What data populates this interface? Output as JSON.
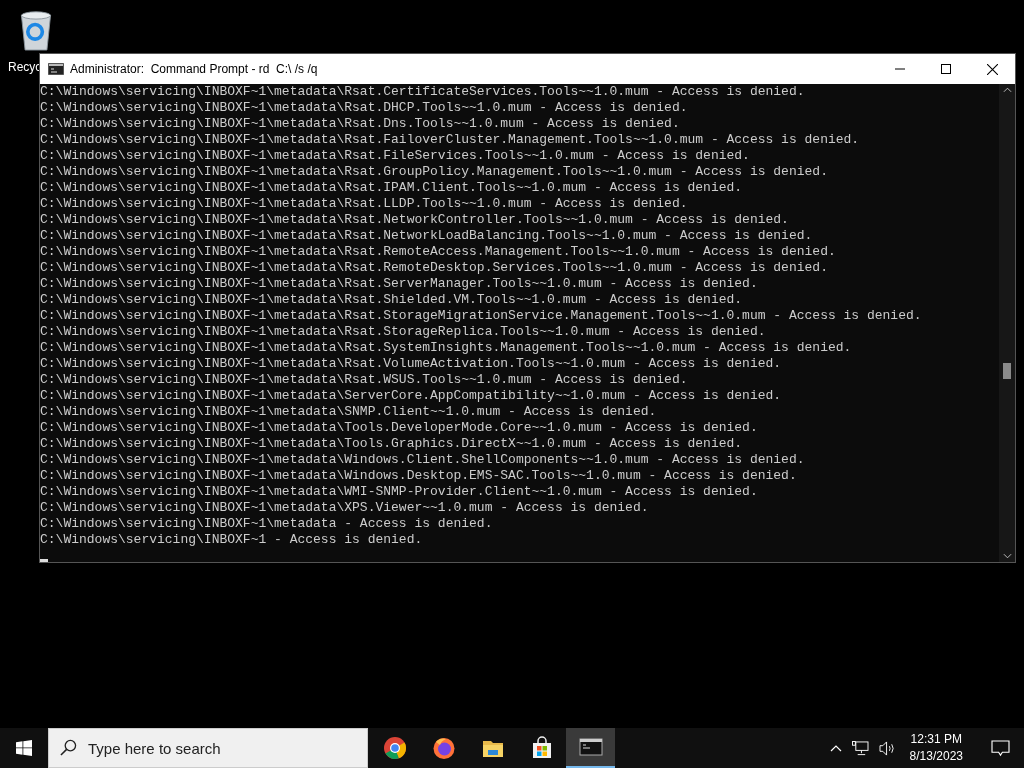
{
  "desktop_icons": [
    {
      "label": "Recyc"
    }
  ],
  "window": {
    "title": "Administrator:  Command Prompt - rd  C:\\ /s /q"
  },
  "console": {
    "lines": [
      "C:\\Windows\\servicing\\INBOXF~1\\metadata\\Rsat.CertificateServices.Tools~~1.0.mum - Access is denied.",
      "C:\\Windows\\servicing\\INBOXF~1\\metadata\\Rsat.DHCP.Tools~~1.0.mum - Access is denied.",
      "C:\\Windows\\servicing\\INBOXF~1\\metadata\\Rsat.Dns.Tools~~1.0.mum - Access is denied.",
      "C:\\Windows\\servicing\\INBOXF~1\\metadata\\Rsat.FailoverCluster.Management.Tools~~1.0.mum - Access is denied.",
      "C:\\Windows\\servicing\\INBOXF~1\\metadata\\Rsat.FileServices.Tools~~1.0.mum - Access is denied.",
      "C:\\Windows\\servicing\\INBOXF~1\\metadata\\Rsat.GroupPolicy.Management.Tools~~1.0.mum - Access is denied.",
      "C:\\Windows\\servicing\\INBOXF~1\\metadata\\Rsat.IPAM.Client.Tools~~1.0.mum - Access is denied.",
      "C:\\Windows\\servicing\\INBOXF~1\\metadata\\Rsat.LLDP.Tools~~1.0.mum - Access is denied.",
      "C:\\Windows\\servicing\\INBOXF~1\\metadata\\Rsat.NetworkController.Tools~~1.0.mum - Access is denied.",
      "C:\\Windows\\servicing\\INBOXF~1\\metadata\\Rsat.NetworkLoadBalancing.Tools~~1.0.mum - Access is denied.",
      "C:\\Windows\\servicing\\INBOXF~1\\metadata\\Rsat.RemoteAccess.Management.Tools~~1.0.mum - Access is denied.",
      "C:\\Windows\\servicing\\INBOXF~1\\metadata\\Rsat.RemoteDesktop.Services.Tools~~1.0.mum - Access is denied.",
      "C:\\Windows\\servicing\\INBOXF~1\\metadata\\Rsat.ServerManager.Tools~~1.0.mum - Access is denied.",
      "C:\\Windows\\servicing\\INBOXF~1\\metadata\\Rsat.Shielded.VM.Tools~~1.0.mum - Access is denied.",
      "C:\\Windows\\servicing\\INBOXF~1\\metadata\\Rsat.StorageMigrationService.Management.Tools~~1.0.mum - Access is denied.",
      "C:\\Windows\\servicing\\INBOXF~1\\metadata\\Rsat.StorageReplica.Tools~~1.0.mum - Access is denied.",
      "C:\\Windows\\servicing\\INBOXF~1\\metadata\\Rsat.SystemInsights.Management.Tools~~1.0.mum - Access is denied.",
      "C:\\Windows\\servicing\\INBOXF~1\\metadata\\Rsat.VolumeActivation.Tools~~1.0.mum - Access is denied.",
      "C:\\Windows\\servicing\\INBOXF~1\\metadata\\Rsat.WSUS.Tools~~1.0.mum - Access is denied.",
      "C:\\Windows\\servicing\\INBOXF~1\\metadata\\ServerCore.AppCompatibility~~1.0.mum - Access is denied.",
      "C:\\Windows\\servicing\\INBOXF~1\\metadata\\SNMP.Client~~1.0.mum - Access is denied.",
      "C:\\Windows\\servicing\\INBOXF~1\\metadata\\Tools.DeveloperMode.Core~~1.0.mum - Access is denied.",
      "C:\\Windows\\servicing\\INBOXF~1\\metadata\\Tools.Graphics.DirectX~~1.0.mum - Access is denied.",
      "C:\\Windows\\servicing\\INBOXF~1\\metadata\\Windows.Client.ShellComponents~~1.0.mum - Access is denied.",
      "C:\\Windows\\servicing\\INBOXF~1\\metadata\\Windows.Desktop.EMS-SAC.Tools~~1.0.mum - Access is denied.",
      "C:\\Windows\\servicing\\INBOXF~1\\metadata\\WMI-SNMP-Provider.Client~~1.0.mum - Access is denied.",
      "C:\\Windows\\servicing\\INBOXF~1\\metadata\\XPS.Viewer~~1.0.mum - Access is denied.",
      "C:\\Windows\\servicing\\INBOXF~1\\metadata - Access is denied.",
      "C:\\Windows\\servicing\\INBOXF~1 - Access is denied."
    ]
  },
  "taskbar": {
    "search": {
      "placeholder": "Type here to search"
    },
    "apps": [
      {
        "kind": "chrome",
        "selected": false
      },
      {
        "kind": "firefox",
        "selected": false
      },
      {
        "kind": "explorer",
        "selected": false
      },
      {
        "kind": "store",
        "selected": false
      },
      {
        "kind": "terminal",
        "selected": true
      }
    ],
    "clock": {
      "time": "12:31 PM",
      "date": "8/13/2023"
    }
  }
}
